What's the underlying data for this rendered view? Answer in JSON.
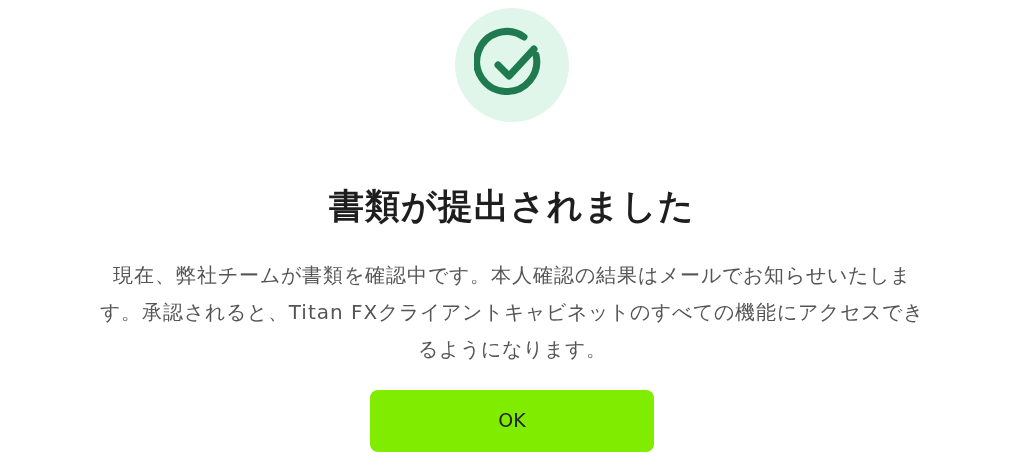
{
  "title": "書類が提出されました",
  "message": "現在、弊社チームが書類を確認中です。本人確認の結果はメールでお知らせいたします。承認されると、Titan FXクライアントキャビネットのすべての機能にアクセスできるようになります。",
  "buttons": [
    "OK"
  ]
}
